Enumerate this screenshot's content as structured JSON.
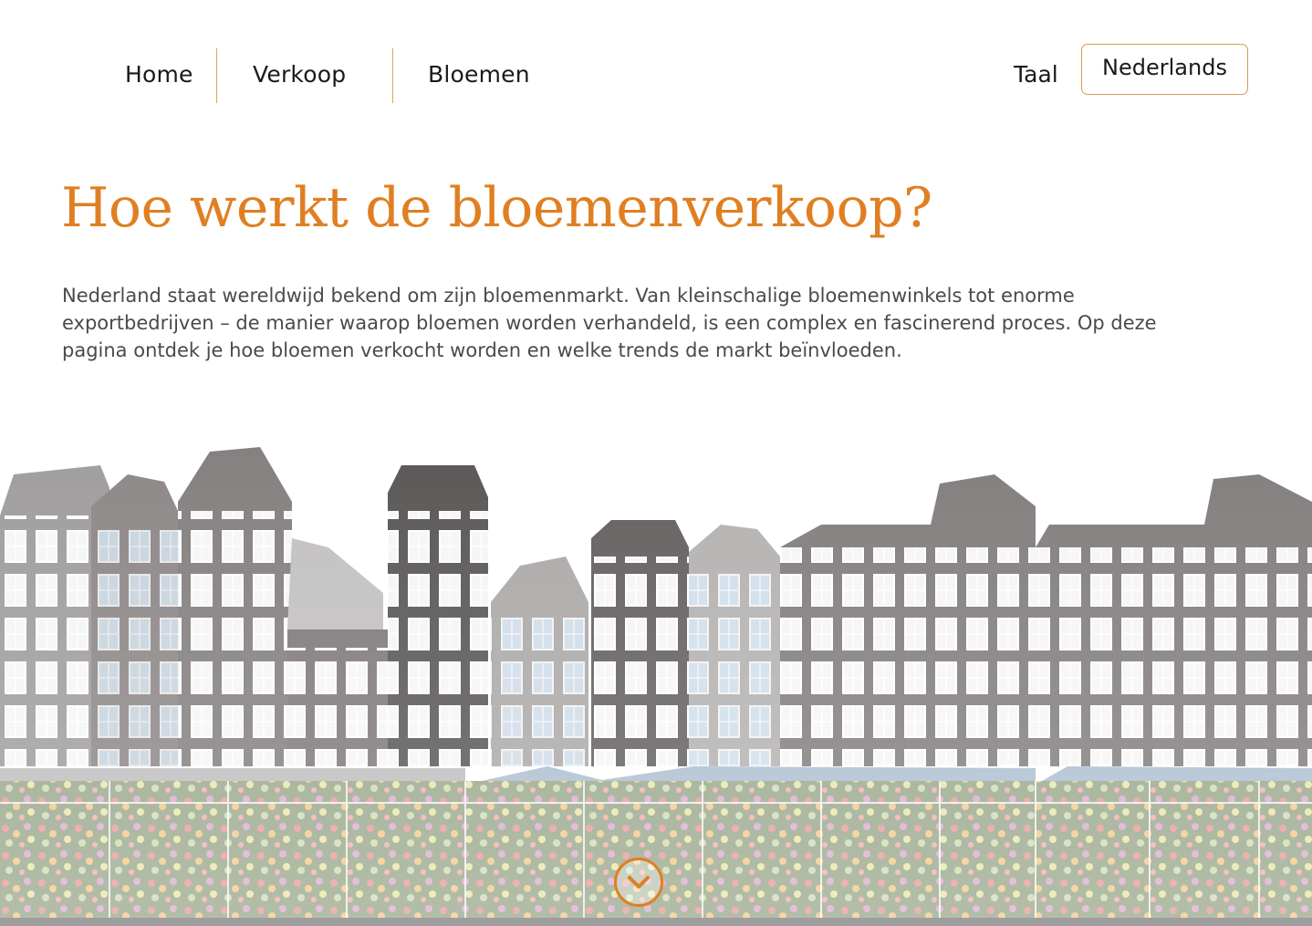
{
  "nav": {
    "items": [
      {
        "label": "Home"
      },
      {
        "label": "Verkoop"
      },
      {
        "label": "Bloemen"
      }
    ],
    "language_label": "Taal",
    "language_selected": "Nederlands"
  },
  "hero": {
    "title": "Hoe werkt de bloemenverkoop?",
    "intro": "Nederland staat wereldwijd bekend om zijn bloemenmarkt. Van kleinschalige bloemenwinkels tot enorme exportbedrijven – de manier waarop bloemen worden verhandeld, is een complex en fascinerend proces. Op deze pagina ontdek je hoe bloemen verkocht worden en welke trends de markt beïnvloeden."
  },
  "colors": {
    "accent": "#e07f22",
    "border": "#d89a52",
    "text": "#1a1a1a",
    "body_text": "#4a4a4a"
  },
  "icons": {
    "scroll_down": "chevron-down-circle-icon"
  }
}
